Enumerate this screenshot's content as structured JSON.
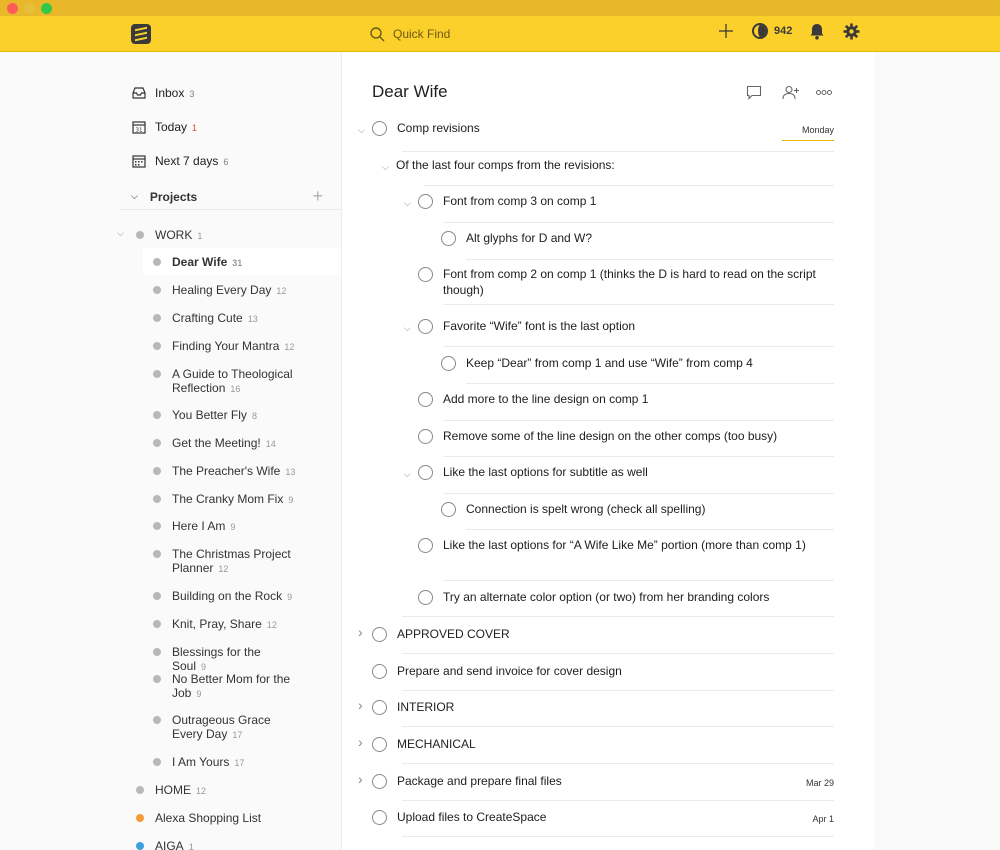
{
  "app": {
    "search_placeholder": "Quick Find",
    "karma_points": "942",
    "accent_color": "#fcd02b",
    "priority_red": "#db4c3f"
  },
  "nav": [
    {
      "label": "Inbox",
      "count": "3",
      "icon": "inbox-icon"
    },
    {
      "label": "Today",
      "count": "1",
      "icon": "calendar-today-icon"
    },
    {
      "label": "Next 7 days",
      "count": "6",
      "icon": "calendar-week-icon"
    }
  ],
  "projects": {
    "header": "Projects",
    "work": {
      "label": "WORK",
      "count": "1"
    },
    "items": [
      {
        "label": "Dear Wife",
        "count": "31"
      },
      {
        "label": "Healing Every Day",
        "count": "12"
      },
      {
        "label": "Crafting Cute",
        "count": "13"
      },
      {
        "label": "Finding Your Mantra",
        "count": "12"
      },
      {
        "label": "A Guide to Theological Reflection",
        "count": "16"
      },
      {
        "label": "You Better Fly",
        "count": "8"
      },
      {
        "label": "Get the Meeting!",
        "count": "14"
      },
      {
        "label": "The Preacher's Wife",
        "count": "13"
      },
      {
        "label": "The Cranky Mom Fix",
        "count": "9"
      },
      {
        "label": "Here I Am",
        "count": "9"
      },
      {
        "label": "The Christmas Project Planner",
        "count": "12"
      },
      {
        "label": "Building on the Rock",
        "count": "9"
      },
      {
        "label": "Knit, Pray, Share",
        "count": "12"
      },
      {
        "label": "Blessings for the Soul",
        "count": "9"
      },
      {
        "label": "No Better Mom for the Job",
        "count": "9"
      },
      {
        "label": "Outrageous Grace Every Day",
        "count": "17"
      },
      {
        "label": "I Am Yours",
        "count": "17"
      }
    ],
    "home": {
      "label": "HOME",
      "count": "12"
    },
    "alexa": {
      "label": "Alexa Shopping List",
      "color": "#f39c38"
    },
    "aiga": {
      "label": "AIGA",
      "count": "1",
      "color": "#3ea0e0"
    }
  },
  "main": {
    "title": "Dear Wife",
    "tasks": [
      {
        "text": "Comp revisions",
        "due": "Monday"
      },
      {
        "text": "Of the last four comps from the revisions:"
      },
      {
        "text": "Font from comp 3 on comp 1"
      },
      {
        "text": "Alt glyphs for D and W?"
      },
      {
        "text": "Font from comp 2 on comp 1 (thinks the D is hard to read on the script though)"
      },
      {
        "text": "Favorite “Wife” font is the last option"
      },
      {
        "text": "Keep “Dear” from comp 1 and use “Wife” from comp 4"
      },
      {
        "text": "Add more to the line design on comp 1"
      },
      {
        "text": "Remove some of the line design on the other comps (too busy)"
      },
      {
        "text": "Like the last options for subtitle as well"
      },
      {
        "text": "Connection is spelt wrong (check all spelling)"
      },
      {
        "text": "Like the last options for “A Wife Like Me” portion (more than comp 1)"
      },
      {
        "text": "Try an alternate color option (or two) from her branding colors"
      },
      {
        "text": "APPROVED COVER"
      },
      {
        "text": "Prepare and send invoice for cover design"
      },
      {
        "text": "INTERIOR"
      },
      {
        "text": "MECHANICAL"
      },
      {
        "text": "Package and prepare final files",
        "due": "Mar 29"
      },
      {
        "text": "Upload files to CreateSpace",
        "due": "Apr 1"
      }
    ]
  }
}
